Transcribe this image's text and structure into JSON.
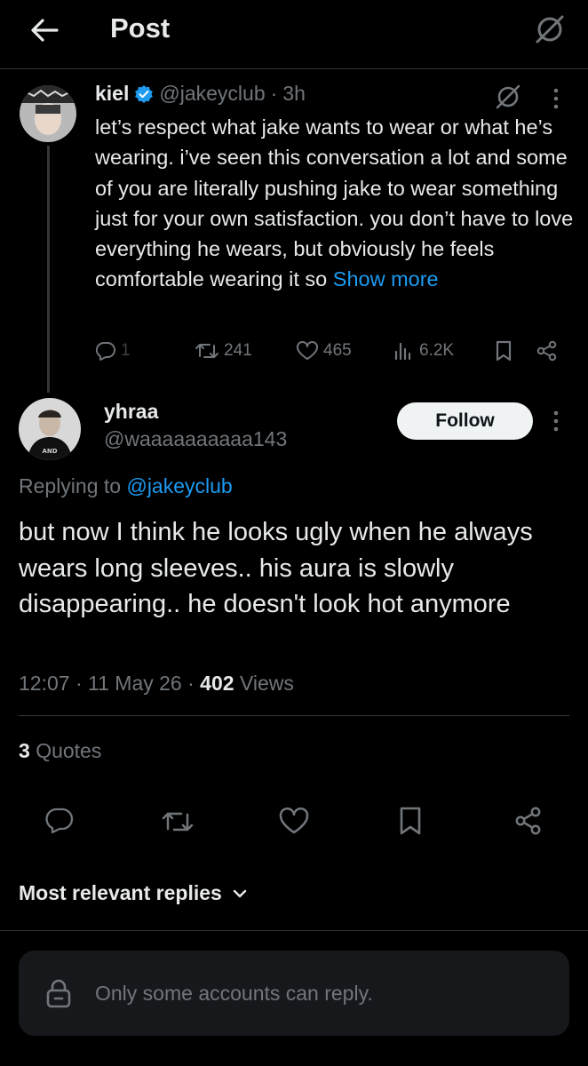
{
  "header": {
    "title": "Post"
  },
  "parent_post": {
    "name": "kiel",
    "handle": "@jakeyclub",
    "separator": "·",
    "time": "3h",
    "text": "let’s respect what jake wants to wear or what he’s wearing. i’ve seen this conversation a lot and some of you are literally pushing jake to wear something just for your own satisfaction. you don’t have to love everything he wears, but obviously he feels comfortable wearing it so ",
    "show_more": "Show more",
    "replies": "1",
    "reposts": "241",
    "likes": "465",
    "views": "6.2K"
  },
  "post": {
    "name": "yhraa",
    "handle": "@waaaaaaaaaa143",
    "follow_label": "Follow",
    "replying_prefix": "Replying to",
    "replying_handle": "@jakeyclub",
    "text": "but now I think he looks ugly when he always wears long sleeves.. his aura is slowly disappearing.. he doesn't look hot anymore",
    "time": "12:07",
    "date": "11 May 26",
    "sep1": "·",
    "sep2": "·",
    "views_count": "402",
    "views_label": "Views",
    "quotes_count": "3",
    "quotes_label": "Quotes"
  },
  "replies_sort": {
    "label": "Most relevant replies"
  },
  "reply_restriction": {
    "text": "Only some accounts can reply."
  },
  "colors": {
    "background": "#000000",
    "accent": "#1d9bf0",
    "muted": "#71767b",
    "text": "#e7e9ea",
    "verified": "#1d9bf0"
  }
}
